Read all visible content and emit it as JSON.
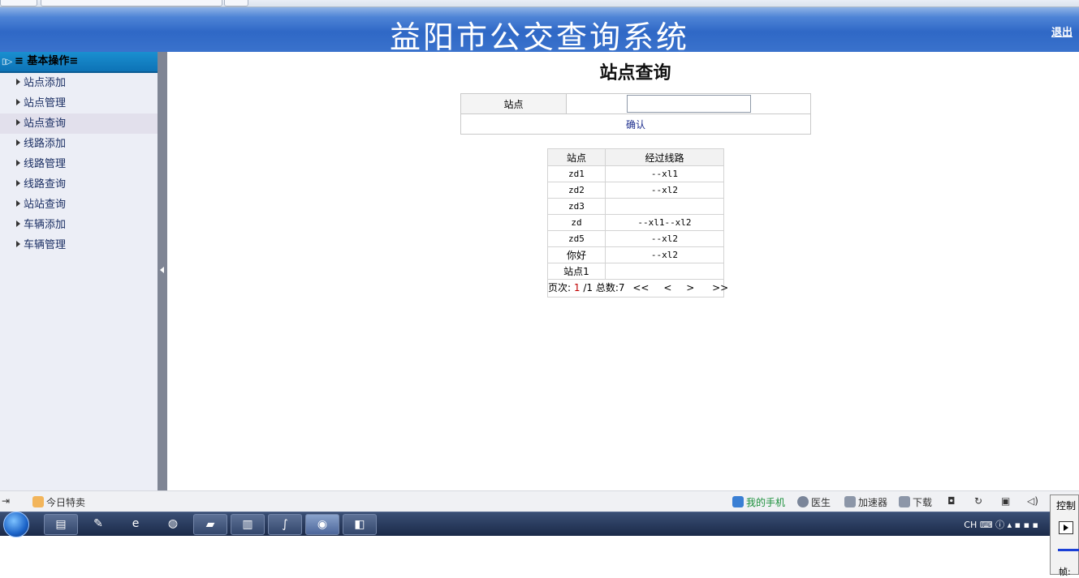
{
  "header": {
    "title": "益阳市公交查询系统",
    "logout": "退出"
  },
  "sidebar": {
    "heading": "≡ 基本操作≡",
    "items": [
      {
        "label": "站点添加"
      },
      {
        "label": "站点管理"
      },
      {
        "label": "站点查询"
      },
      {
        "label": "线路添加"
      },
      {
        "label": "线路管理"
      },
      {
        "label": "线路查询"
      },
      {
        "label": "站站查询"
      },
      {
        "label": "车辆添加"
      },
      {
        "label": "车辆管理"
      }
    ]
  },
  "main": {
    "title": "站点查询",
    "form": {
      "label": "站点",
      "input_value": "",
      "confirm": "确认"
    },
    "table": {
      "headers": [
        "站点",
        "经过线路"
      ],
      "rows": [
        [
          "zd1",
          "--xl1"
        ],
        [
          "zd2",
          "--xl2"
        ],
        [
          "zd3",
          ""
        ],
        [
          "zd",
          "--xl1--xl2"
        ],
        [
          "zd5",
          "--xl2"
        ],
        [
          "你好",
          "--xl2"
        ],
        [
          "站点1",
          ""
        ]
      ]
    },
    "pager": {
      "label": "页次:",
      "current": "1",
      "total_pages": "/1",
      "count_label": "总数:",
      "count": "7",
      "first": "<<",
      "prev": "<",
      "next": ">",
      "last": ">>"
    }
  },
  "quickbar": {
    "left": "今日特卖",
    "right": [
      "我的手机",
      "医生",
      "加速器",
      "下载"
    ]
  },
  "taskbar": {
    "tray_text": "CH"
  },
  "control_panel": {
    "title": "控制",
    "frame": "帧:"
  }
}
